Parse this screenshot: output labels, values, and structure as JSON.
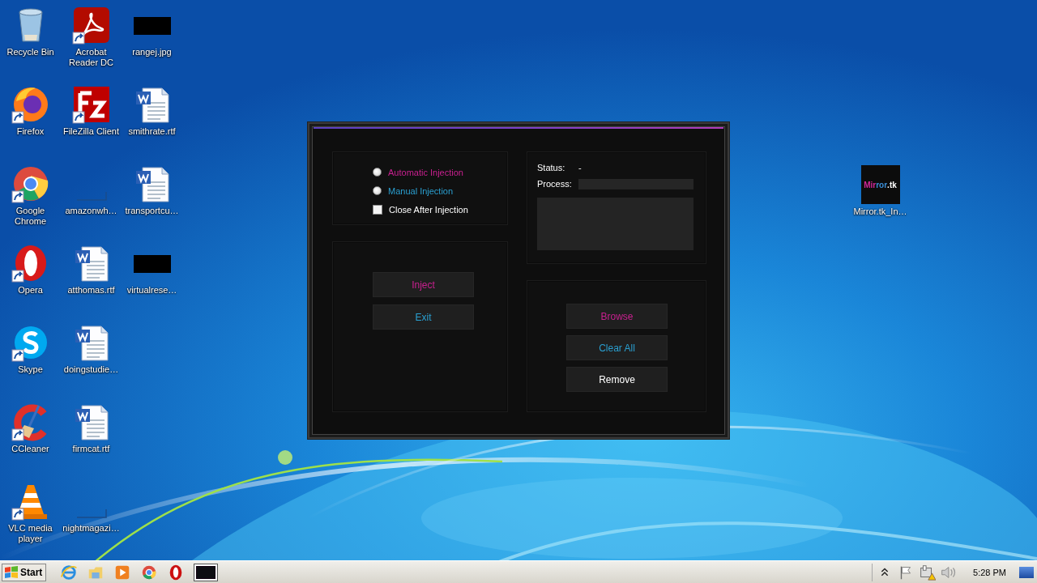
{
  "desktop": {
    "icons": [
      {
        "label": "Recycle Bin",
        "kind": "recycle",
        "shortcut": false
      },
      {
        "label": "Firefox",
        "kind": "firefox",
        "shortcut": true
      },
      {
        "label": "Google Chrome",
        "kind": "chrome",
        "shortcut": true
      },
      {
        "label": "Opera",
        "kind": "opera",
        "shortcut": true
      },
      {
        "label": "Skype",
        "kind": "skype",
        "shortcut": true
      },
      {
        "label": "CCleaner",
        "kind": "ccleaner",
        "shortcut": true
      },
      {
        "label": "VLC media player",
        "kind": "vlc",
        "shortcut": true
      },
      {
        "label": "Acrobat Reader DC",
        "kind": "acrobat",
        "shortcut": true
      },
      {
        "label": "FileZilla Client",
        "kind": "filezilla",
        "shortcut": true
      },
      {
        "label": "amazonwh…",
        "kind": "blank",
        "shortcut": false
      },
      {
        "label": "atthomas.rtf",
        "kind": "document",
        "shortcut": false
      },
      {
        "label": "doingstudie…",
        "kind": "document",
        "shortcut": false
      },
      {
        "label": "firmcat.rtf",
        "kind": "document",
        "shortcut": false
      },
      {
        "label": "nightmagazi…",
        "kind": "blank",
        "shortcut": false
      },
      {
        "label": "rangej.jpg",
        "kind": "dark",
        "shortcut": false
      },
      {
        "label": "smithrate.rtf",
        "kind": "document",
        "shortcut": false
      },
      {
        "label": "transportcu…",
        "kind": "document",
        "shortcut": false
      },
      {
        "label": "virtualrese…",
        "kind": "dark",
        "shortcut": false
      }
    ],
    "floating_icon": {
      "label": "Mirror.tk_In…",
      "logo_parts": [
        {
          "text": "Mir",
          "color": "#d02898"
        },
        {
          "text": "ror",
          "color": "#3a8fd8"
        },
        {
          "text": ".tk",
          "color": "#ffffff"
        }
      ]
    }
  },
  "app_window": {
    "options": [
      {
        "kind": "radio",
        "label": "Automatic Injection",
        "selected": false,
        "color": "#c8208f"
      },
      {
        "kind": "radio",
        "label": "Manual Injection",
        "selected": false,
        "color": "#2a9fd0"
      },
      {
        "kind": "checkbox",
        "label": "Close After Injection",
        "checked": false,
        "color": "#ffffff"
      }
    ],
    "action_buttons": [
      {
        "label": "Inject",
        "color": "#c8208f"
      },
      {
        "label": "Exit",
        "color": "#2a9fd0"
      }
    ],
    "status": {
      "label": "Status:",
      "value": "-"
    },
    "process": {
      "label": "Process:"
    },
    "file_buttons": [
      {
        "label": "Browse",
        "color": "#c8208f"
      },
      {
        "label": "Clear All",
        "color": "#2a9fd0"
      },
      {
        "label": "Remove",
        "color": "#ffffff"
      }
    ]
  },
  "taskbar": {
    "start": "Start",
    "apps": [
      {
        "kind": "ie"
      },
      {
        "kind": "explorer"
      },
      {
        "kind": "player"
      },
      {
        "kind": "chrome"
      },
      {
        "kind": "opera"
      },
      {
        "kind": "window"
      }
    ],
    "tray": [
      {
        "kind": "chevron"
      },
      {
        "kind": "flag"
      },
      {
        "kind": "network"
      },
      {
        "kind": "speaker"
      }
    ],
    "clock": "5:28 PM"
  }
}
